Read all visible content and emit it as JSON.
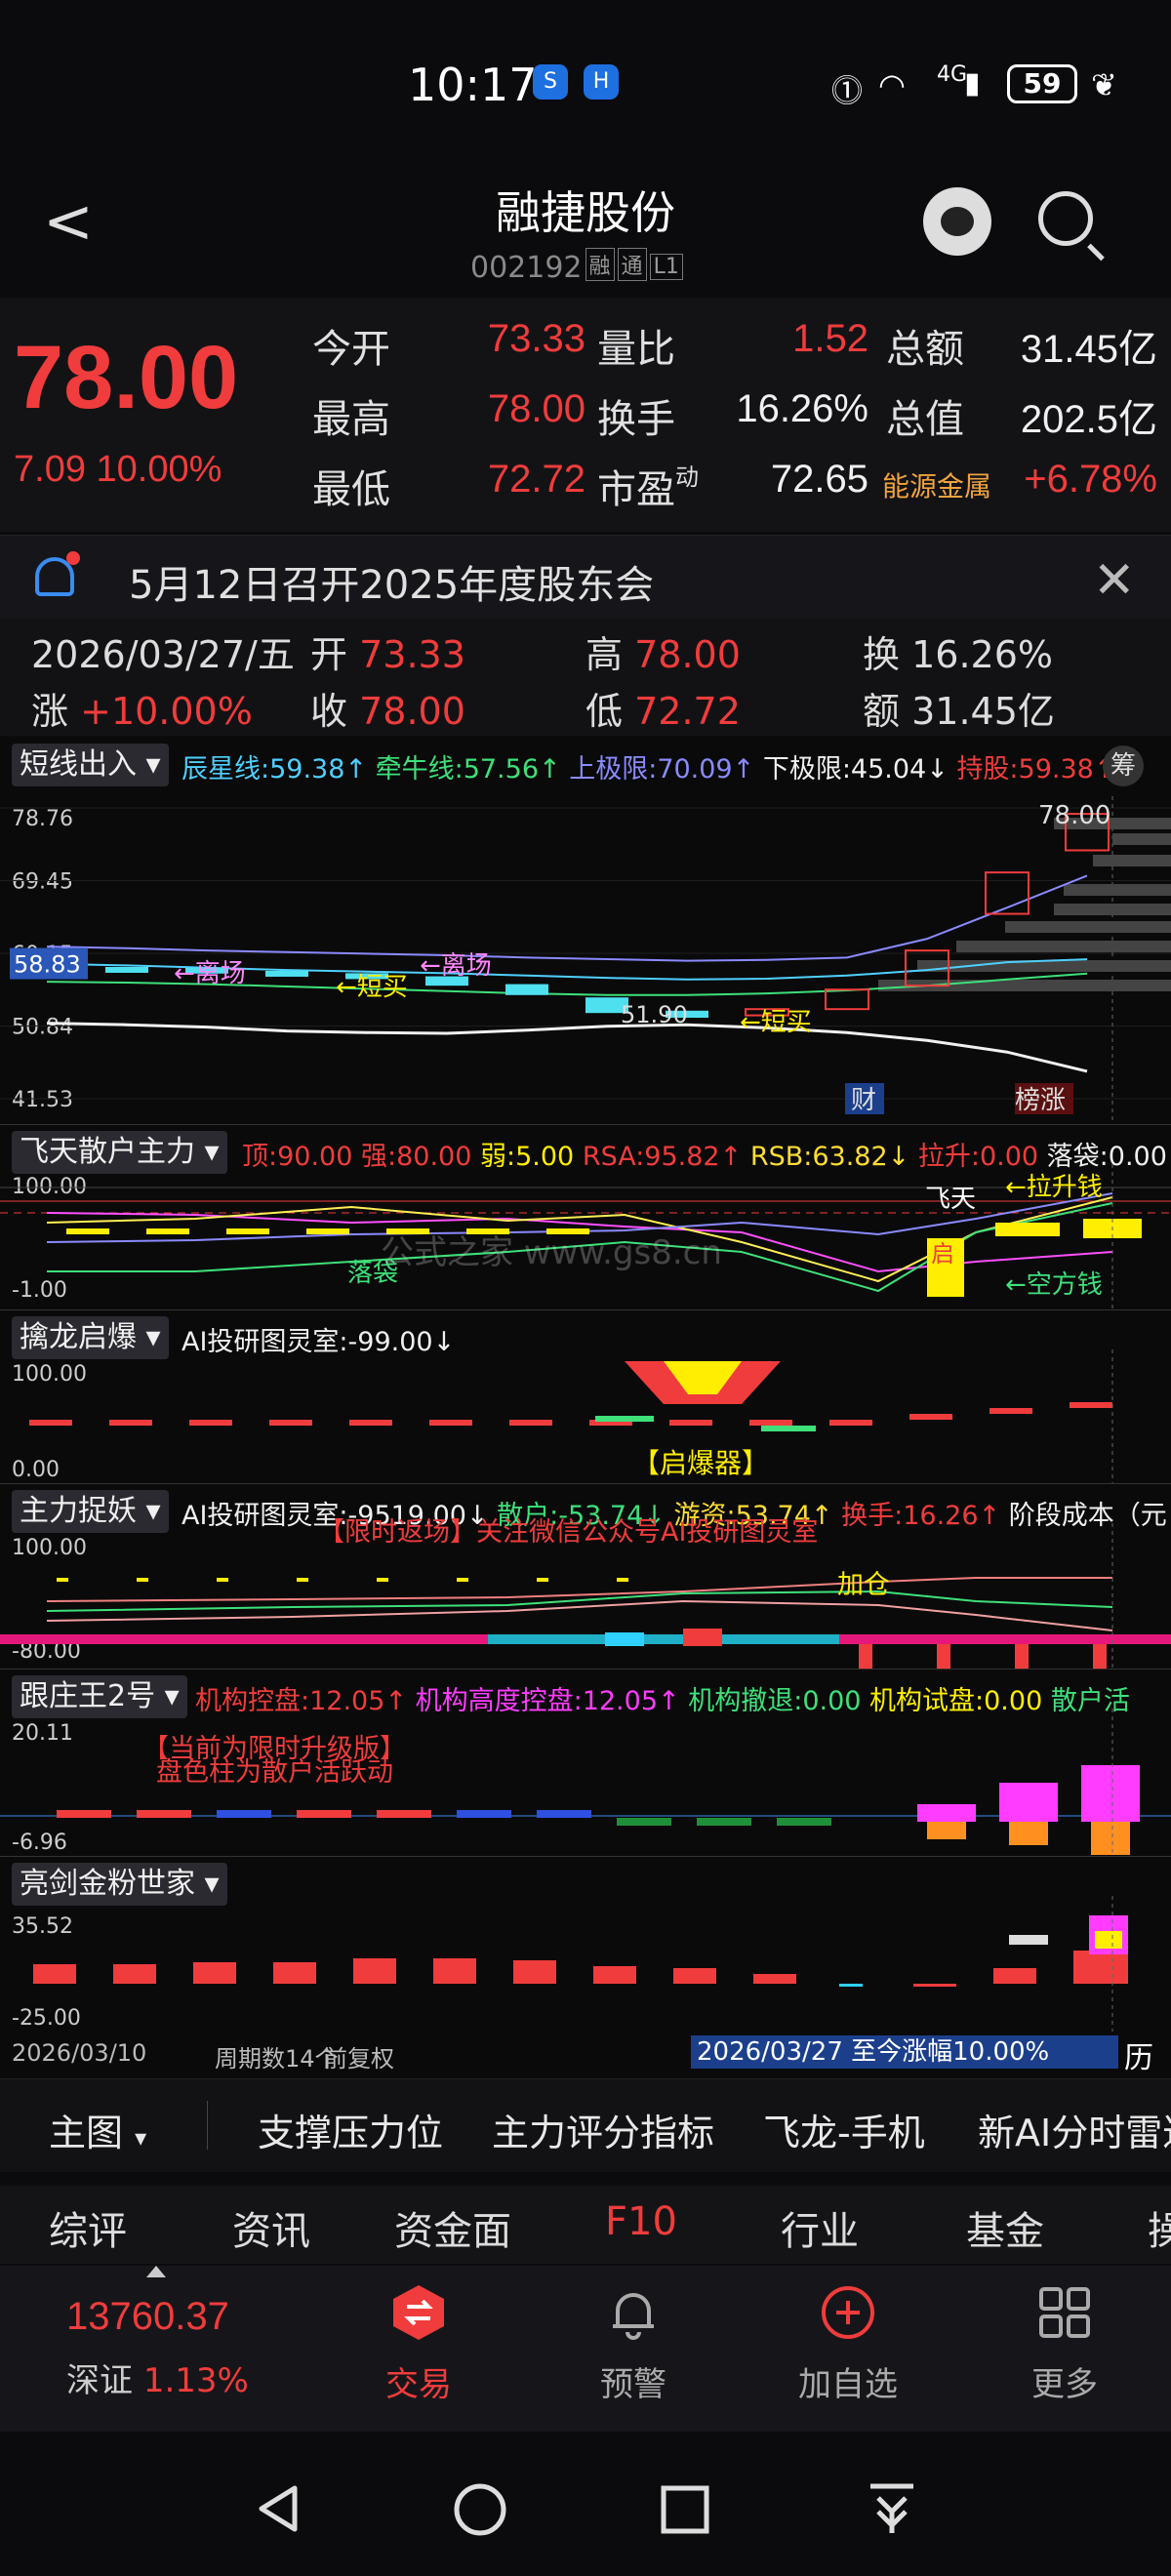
{
  "status_bar": {
    "time": "10:17",
    "app_icon_1": "S",
    "app_icon_2": "H",
    "network": "4G",
    "battery": "59"
  },
  "header": {
    "title": "融捷股份",
    "code": "002192",
    "tags": [
      "融",
      "通",
      "L1"
    ]
  },
  "quote": {
    "price": "78.00",
    "change": "7.09 10.00%",
    "rows": [
      [
        {
          "label": "今开",
          "value": "73.33"
        },
        {
          "label": "量比",
          "value": "1.52"
        },
        {
          "label": "总额",
          "value": "31.45亿"
        }
      ],
      [
        {
          "label": "最高",
          "value": "78.00"
        },
        {
          "label": "换手",
          "value": "16.26%"
        },
        {
          "label": "总值",
          "value": "202.5亿"
        }
      ],
      [
        {
          "label": "最低",
          "value": "72.72"
        },
        {
          "label": "市盈",
          "value": "72.65"
        },
        {
          "label": "能源金属",
          "value": "+6.78%"
        }
      ]
    ],
    "pe_sup": "动"
  },
  "notice": {
    "text": "5月12日召开2025年度股东会"
  },
  "info_row": {
    "date": "2026/03/27/五",
    "open_label": "开",
    "open": "73.33",
    "high_label": "高",
    "high": "78.00",
    "turnover_label": "换",
    "turnover": "16.26%",
    "change_label": "涨",
    "change": "+10.00%",
    "close_label": "收",
    "close": "78.00",
    "low_label": "低",
    "low": "72.72",
    "amount_label": "额",
    "amount": "31.45亿"
  },
  "main_chart": {
    "indicator": "短线出入",
    "lines": [
      {
        "text": "辰星线:59.38↑",
        "color": "#4fd0ff"
      },
      {
        "text": "牵牛线:57.56↑",
        "color": "#3ee07a"
      },
      {
        "text": "上极限:70.09↑",
        "color": "#8a8aff"
      },
      {
        "text": "下极限:45.04↓",
        "color": "#f0f0f0"
      },
      {
        "text": "持股:59.38↑",
        "color": "#f03c3c"
      }
    ],
    "chip_label": "筹",
    "axis": [
      "78.76",
      "69.45",
      "60.15",
      "50.84",
      "41.53"
    ],
    "current": "58.83",
    "labels": {
      "exit1": "←离场",
      "exit2": "←离场",
      "buy1": "←短买",
      "buy2": "←短买",
      "low_val": "51.90",
      "high_val": "78.00",
      "fin": "财",
      "list": "榜涨"
    }
  },
  "chart_data": [
    {
      "type": "candlestick",
      "title": "短线出入",
      "ylim": [
        41.53,
        78.76
      ],
      "ticks": [
        "78.76",
        "69.45",
        "60.15",
        "50.84",
        "41.53"
      ],
      "candles": [
        {
          "o": 58.6,
          "c": 58.2
        },
        {
          "o": 58.4,
          "c": 58.0
        },
        {
          "o": 58.3,
          "c": 57.8
        },
        {
          "o": 57.9,
          "c": 57.4
        },
        {
          "o": 57.6,
          "c": 57.0
        },
        {
          "o": 57.2,
          "c": 56.0
        },
        {
          "o": 56.2,
          "c": 54.8
        },
        {
          "o": 54.5,
          "c": 52.5
        },
        {
          "o": 52.8,
          "c": 51.9
        },
        {
          "o": 52.2,
          "c": 53.0
        },
        {
          "o": 53.0,
          "c": 55.5
        },
        {
          "o": 56.0,
          "c": 60.5
        },
        {
          "o": 65.2,
          "c": 70.5
        },
        {
          "o": 73.33,
          "c": 78.0
        }
      ],
      "series": [
        {
          "name": "辰星线",
          "values": [
            58.8,
            58.6,
            58.3,
            58.0,
            57.8,
            57.6,
            57.3,
            57.0,
            56.8,
            56.9,
            57.3,
            58.0,
            59.0,
            59.38
          ]
        },
        {
          "name": "牵牛线",
          "values": [
            56.5,
            56.4,
            56.2,
            55.9,
            55.6,
            55.3,
            55.0,
            54.8,
            54.8,
            55.0,
            55.4,
            56.0,
            56.8,
            57.56
          ]
        },
        {
          "name": "上极限",
          "values": [
            61.0,
            60.8,
            60.5,
            60.3,
            60.1,
            59.9,
            59.6,
            59.4,
            59.2,
            59.3,
            59.6,
            62.0,
            66.0,
            70.09
          ]
        },
        {
          "name": "下极限",
          "values": [
            51.2,
            51.0,
            50.7,
            50.2,
            50.0,
            49.9,
            50.3,
            50.8,
            51.0,
            50.6,
            50.0,
            49.0,
            47.5,
            45.04
          ]
        }
      ]
    }
  ],
  "ind1": {
    "name": "飞天散户主力",
    "line": [
      {
        "text": "顶:90.00",
        "color": "#f03c3c"
      },
      {
        "text": "强:80.00",
        "color": "#f03c3c"
      },
      {
        "text": "弱:5.00",
        "color": "#ffee00"
      },
      {
        "text": "RSA:95.82↑",
        "color": "#f03c3c"
      },
      {
        "text": "RSB:63.82↓",
        "color": "#ffdd33"
      },
      {
        "text": "拉升:0.00",
        "color": "#f03c3c"
      },
      {
        "text": "落袋:0.00",
        "color": "#f0f0f0"
      }
    ],
    "axis": [
      "100.00",
      "-1.00"
    ],
    "labels": {
      "fly": "飞天",
      "launch": "启",
      "dropbag": "落袋",
      "pull": "←拉升钱",
      "empty": "←空方钱"
    }
  },
  "ind2": {
    "name": "擒龙启爆",
    "line": [
      {
        "text": "AI投研图灵室:-99.00↓",
        "color": "#f0f0f0"
      }
    ],
    "axis": [
      "100.00",
      "0.00"
    ],
    "labels": {
      "burst": "【启爆器】"
    }
  },
  "ind3": {
    "name": "主力捉妖",
    "line": [
      {
        "text": "AI投研图灵室:-9519.00↓",
        "color": "#f0f0f0"
      },
      {
        "text": "散户:-53.74↓",
        "color": "#3ee07a"
      },
      {
        "text": "游资:53.74↑",
        "color": "#ffdd33"
      },
      {
        "text": "换手:16.26↑",
        "color": "#f03c3c"
      },
      {
        "text": "阶段成本（元",
        "color": "#f0f0f0"
      }
    ],
    "axis": [
      "100.00",
      "-80.00"
    ],
    "labels": {
      "promo": "【限时返场】关注微信公众号AI投研图灵室",
      "add": "加仓"
    }
  },
  "ind4": {
    "name": "跟庄王2号",
    "line": [
      {
        "text": "机构控盘:12.05↑",
        "color": "#f03c3c"
      },
      {
        "text": "机构高度控盘:12.05↑",
        "color": "#ff3cff"
      },
      {
        "text": "机构撤退:0.00",
        "color": "#3ee07a"
      },
      {
        "text": "机构试盘:0.00",
        "color": "#ffee00"
      },
      {
        "text": "散户活",
        "color": "#3ee07a"
      }
    ],
    "axis": [
      "20.11",
      "-6.96"
    ],
    "labels": {
      "tip1": "【当前为限时升级版】",
      "tip2": "盘色柱为散户活跃动"
    }
  },
  "ind5": {
    "name": "亮剑金粉世家",
    "axis": [
      "35.52",
      "-25.00"
    ]
  },
  "period": {
    "start": "2026/03/10",
    "count": "周期数14个",
    "adjust": "前复权",
    "range": "2026/03/27 至今涨幅10.00%",
    "history": "历"
  },
  "toolbar": {
    "items": [
      "主图",
      "支撑压力位",
      "主力评分指标",
      "飞龙-手机",
      "新AI分时雷达"
    ]
  },
  "tabs": {
    "items": [
      "综评",
      "资讯",
      "资金面",
      "F10",
      "行业",
      "基金",
      "操"
    ]
  },
  "nav": {
    "index_value": "13760.37",
    "index_name": "深证",
    "index_change": "1.13%",
    "items": [
      "交易",
      "预警",
      "加自选",
      "更多"
    ]
  },
  "watermark": "公式之家 www.gs8.cn",
  "colors": {
    "up": "#f03c3c",
    "down": "#3ee07a",
    "bg": "#0a0a0a"
  }
}
